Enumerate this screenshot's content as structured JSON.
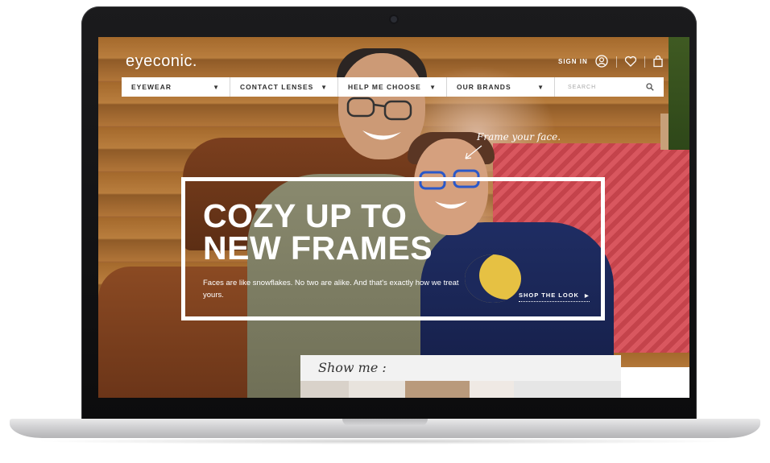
{
  "brand": {
    "logo_text": "eyeconic."
  },
  "header": {
    "sign_in_label": "SIGN IN",
    "icons": [
      "account-icon",
      "heart-icon",
      "bag-icon"
    ]
  },
  "nav": {
    "items": [
      {
        "label": "EYEWEAR"
      },
      {
        "label": "CONTACT LENSES"
      },
      {
        "label": "HELP ME CHOOSE"
      },
      {
        "label": "OUR BRANDS"
      }
    ],
    "caret": "▼",
    "search_placeholder": "SEARCH"
  },
  "hero": {
    "tagline": "Frame your face.",
    "headline_line1": "COZY UP TO",
    "headline_line2": "NEW FRAMES",
    "subtext": "Faces are like snowflakes. No two are alike. And that's exactly how we treat yours.",
    "cta_label": "SHOP THE LOOK",
    "cta_arrow": "▶"
  },
  "show_me": {
    "label": "Show me :"
  },
  "colors": {
    "nav_background": "#ffffff",
    "hero_text": "#ffffff",
    "laptop_bezel": "#111112",
    "laptop_base": "#cfcfd1"
  }
}
